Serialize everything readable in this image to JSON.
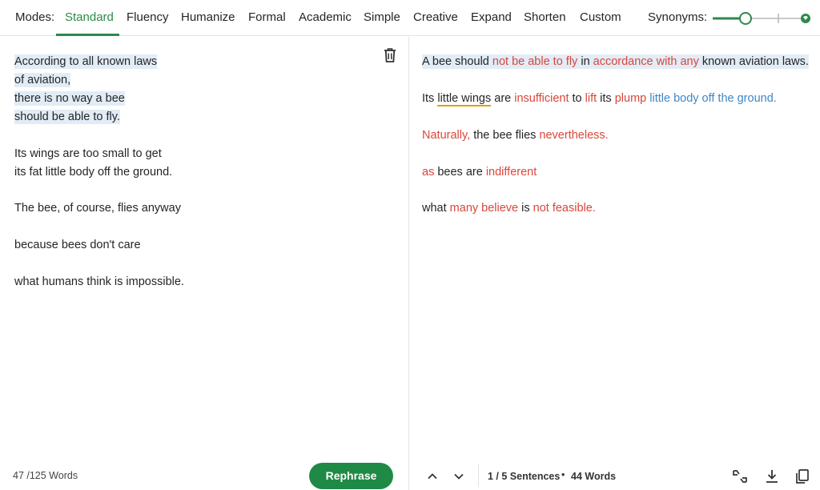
{
  "modebar": {
    "modes_label": "Modes:",
    "tabs": [
      "Standard",
      "Fluency",
      "Humanize",
      "Formal",
      "Academic",
      "Simple",
      "Creative",
      "Expand",
      "Shorten",
      "Custom"
    ],
    "active_tab": "Standard",
    "synonyms_label": "Synonyms:",
    "synonyms_level": 0.35
  },
  "input": {
    "lines": [
      "According to all known laws",
      "of aviation,",
      "there is no way a bee",
      "should be able to fly.",
      "Its wings are too small to get",
      "its fat little body off the ground.",
      "The bee, of course, flies anyway",
      "because bees don't care",
      "what humans think is impossible."
    ],
    "word_count": "47 /125 Words",
    "rephrase_label": "Rephrase"
  },
  "output": {
    "s1": [
      "A bee should ",
      "not be able to fly",
      " in ",
      "accordance with any",
      " known aviation laws."
    ],
    "s2": [
      "Its ",
      "little wings",
      " are ",
      "insufficient",
      " to ",
      "lift",
      " its ",
      "plump",
      " ",
      "little body off the ground."
    ],
    "s3": [
      "Naturally,",
      " the bee flies ",
      "nevertheless."
    ],
    "s4": [
      "as",
      " bees are ",
      "indifferent"
    ],
    "s5": [
      "what ",
      "many believe",
      " is ",
      "not feasible."
    ],
    "sentence_status": "1 / 5 Sentences",
    "bullet": "•",
    "word_count": "44 Words"
  },
  "colors": {
    "accent": "#2b8a4a",
    "changed": "#d9463a",
    "structure": "#3f86c7",
    "highlight": "#e2ecf6"
  },
  "icons": [
    "trash-icon",
    "chevron-up-icon",
    "chevron-down-icon",
    "compare-icon",
    "download-icon",
    "copy-icon"
  ]
}
